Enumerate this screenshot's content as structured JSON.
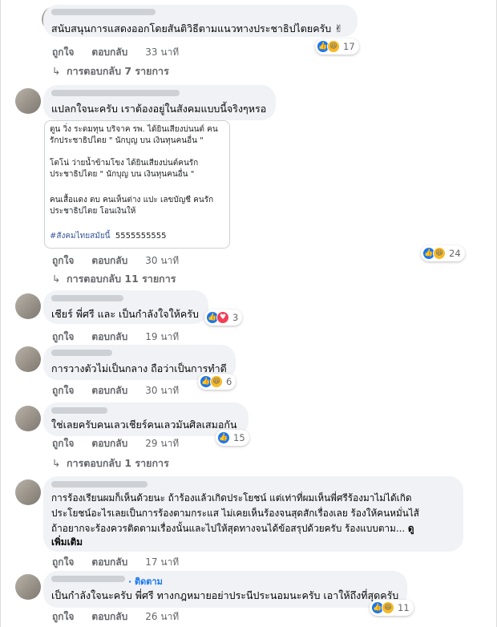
{
  "comments": [
    {
      "text": "สนับสนุนการแสดงออกโดยสันติวิธีตามแนวทางประชาธิปไตยครับ ✌",
      "actions": {
        "like": "ถูกใจ",
        "reply": "ตอบกลับ",
        "time": "33 นาที"
      },
      "reactions": {
        "count": "17",
        "icons": [
          "like-icon",
          "haha-icon"
        ]
      },
      "replies": "การตอบกลับ 7 รายการ"
    },
    {
      "text": "แปลกใจนะครับ เราต้องอยู่ในสังคมแบบนี้จริงๆหรอ",
      "attachment": {
        "lines": [
          "ตูน วิ่ง ระดมทุน บริจาค รพ. ได้ยินเสียงบ่นนต์ คน",
          "รักประชาธิปไตย \" นักบุญ บน เงินทุนคนอื่น \"",
          "",
          "โตโน่ ว่ายน้ำข้ามโขง ได้ยินเสียงบ่นต์คนรัก",
          "ประชาธิปไตย \" นักบุญ บน เงินทุนคนอื่น \"",
          "",
          "คนเสื้อแดง ตบ คนเห็นต่าง แปะ เลขบัญชี คนรัก",
          "ประชาธิปไตย โอนเงินให้"
        ],
        "hashtag": "#สังคมไทยสมัยนี้",
        "tail": "5555555555"
      },
      "actions": {
        "like": "ถูกใจ",
        "reply": "ตอบกลับ",
        "time": "30 นาที"
      },
      "reactions": {
        "count": "24",
        "icons": [
          "like-icon",
          "haha-icon"
        ]
      },
      "replies": "การตอบกลับ 11 รายการ"
    },
    {
      "text": "เชียร์ พี่ศรี และ เป็นกำลังใจให้ครับ",
      "actions": {
        "like": "ถูกใจ",
        "reply": "ตอบกลับ",
        "time": "19 นาที"
      },
      "reactions": {
        "count": "3",
        "icons": [
          "like-icon",
          "love-icon"
        ]
      }
    },
    {
      "text": "การวางตัวไม่เป็นกลาง ถือว่าเป็นการทำดี",
      "actions": {
        "like": "ถูกใจ",
        "reply": "ตอบกลับ",
        "time": "30 นาที"
      },
      "reactions": {
        "count": "6",
        "icons": [
          "like-icon",
          "haha-icon"
        ]
      }
    },
    {
      "text": "ใช่เลยครับคนเลวเชียร์คนเลวมันศิลเสมอกัน",
      "actions": {
        "like": "ถูกใจ",
        "reply": "ตอบกลับ",
        "time": "29 นาที"
      },
      "reactions": {
        "count": "15",
        "icons": [
          "like-icon"
        ]
      },
      "replies": "การตอบกลับ 1 รายการ"
    },
    {
      "lines": [
        "การร้องเรียนผมก็เห็นด้วยนะ ถ้าร้องแล้วเกิดประโยชน์ แต่เท่าที่ผมเห็นพี่ศรีร้องมาไม่ได้เกิด",
        "ประโยชน์อะไรเลยเป็นการร้องตามกระแส ไม่เคยเห็นร้องจนสุดสักเรื่องเลย ร้องให้คนหมั่นไส้",
        "ถ้าอยากจะร้องควรติดตามเรื่องนั้นและไปให้สุดทางจนได้ข้อสรุปด้วยครับ ร้องแบบตาม... "
      ],
      "see_more": "ดู",
      "see_more_2": "เพิ่มเติม",
      "actions": {
        "like": "ถูกใจ",
        "reply": "ตอบกลับ",
        "time": "17 นาที"
      }
    },
    {
      "follow": "· ติดตาม",
      "text": "เป็นกำลังใจนะครับ พี่ศรี ทางกฎหมายอย่าประนีประนอมนะครับ เอาให้ถึงที่สุดครับ",
      "actions": {
        "like": "ถูกใจ",
        "reply": "ตอบกลับ",
        "time": "26 นาที"
      },
      "reactions": {
        "count": "11",
        "icons": [
          "like-icon",
          "haha-icon"
        ]
      }
    }
  ],
  "colors": {
    "like": "#1877f2",
    "haha": "#f7b928",
    "love": "#f33e58",
    "bubble": "#f0f2f5",
    "meta": "#65676b"
  }
}
